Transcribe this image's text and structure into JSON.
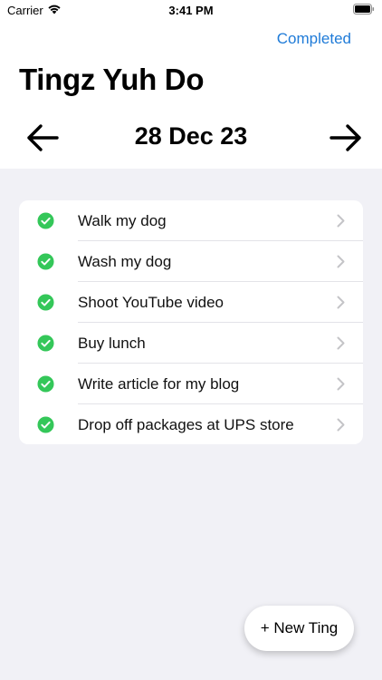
{
  "status_bar": {
    "carrier": "Carrier",
    "time": "3:41 PM"
  },
  "nav": {
    "completed_label": "Completed"
  },
  "header": {
    "title": "Tingz Yuh Do",
    "date": "28 Dec 23"
  },
  "tasks": [
    {
      "label": "Walk my dog"
    },
    {
      "label": "Wash my dog"
    },
    {
      "label": "Shoot YouTube video"
    },
    {
      "label": "Buy lunch"
    },
    {
      "label": "Write article for my blog"
    },
    {
      "label": "Drop off packages at UPS store"
    }
  ],
  "new_button": {
    "label": "+ New Ting"
  },
  "icons": {
    "check": "check-circle-icon",
    "chevron": "chevron-right-icon",
    "prev": "arrow-left-icon",
    "next": "arrow-right-icon"
  },
  "colors": {
    "accent": "#1F7BD8",
    "check_green": "#34C759",
    "background": "#F1F1F6"
  }
}
